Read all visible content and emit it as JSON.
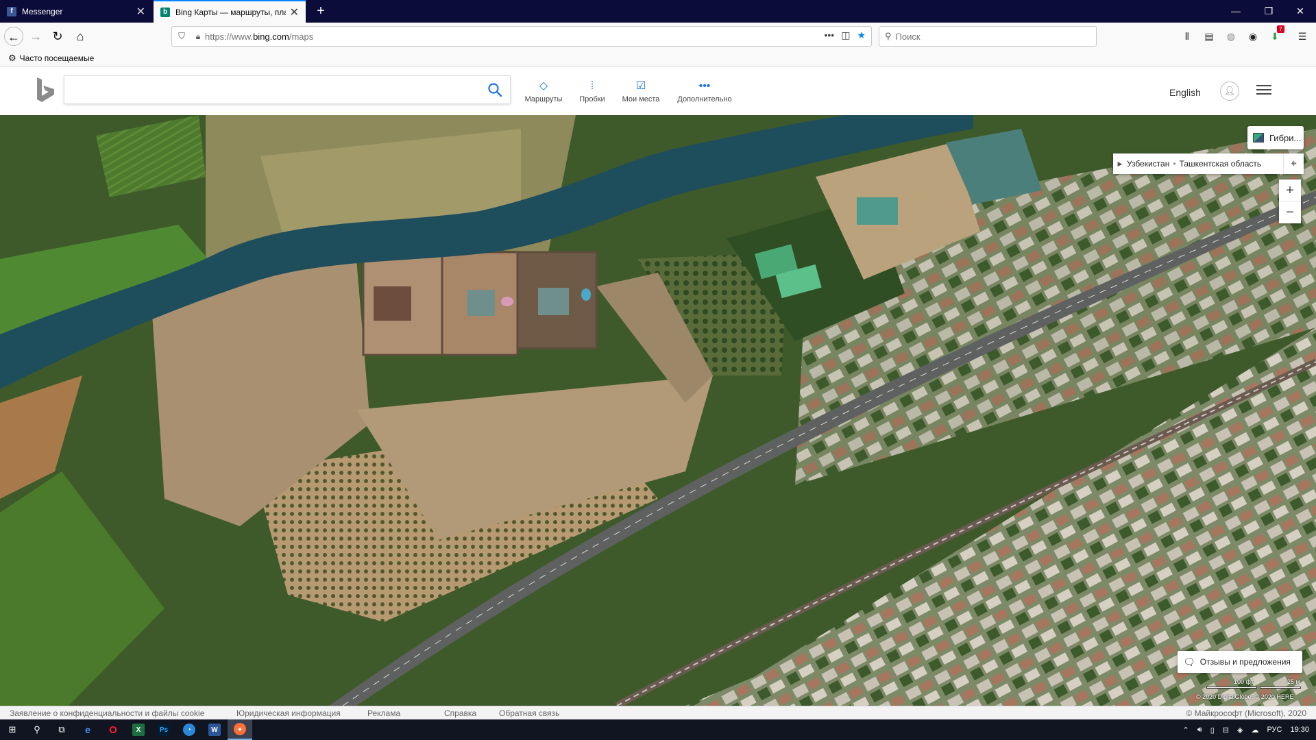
{
  "browser": {
    "tabs": [
      {
        "title": "Messenger",
        "favicon": "facebook-icon",
        "active": false
      },
      {
        "title": "Bing Карты — маршруты, пла",
        "favicon": "bing-icon",
        "active": true
      }
    ],
    "url": {
      "scheme": "https://www.",
      "domain": "bing.com",
      "path": "/maps"
    },
    "search_placeholder": "Поиск",
    "bookmark_item": "Часто посещаемые",
    "notification_count": "7"
  },
  "bing": {
    "nav": [
      {
        "label": "Маршруты",
        "icon": "directions-icon"
      },
      {
        "label": "Пробки",
        "icon": "traffic-icon"
      },
      {
        "label": "Мои места",
        "icon": "my-places-icon"
      },
      {
        "label": "Дополнительно",
        "icon": "more-icon"
      }
    ],
    "language": "English"
  },
  "map": {
    "layer_button": "Гибри...",
    "breadcrumb": [
      "Узбекистан",
      "Ташкентская область"
    ],
    "zoom_in": "+",
    "zoom_out": "−",
    "feedback": "Отзывы и предложения",
    "scale": {
      "imperial": "100 фт.",
      "metric": "25 м"
    },
    "attribution": "© 2020 DigitalGlobe, © 2020 HERE"
  },
  "footer": {
    "links": [
      "Заявление о конфиденциальности и файлы cookie",
      "Юридическая информация",
      "Реклама",
      "Справка",
      "Обратная связь"
    ],
    "copyright": "© Майкрософт (Microsoft), 2020"
  },
  "taskbar": {
    "language": "РУС",
    "time": "19:30"
  },
  "colors": {
    "accent": "#0a84ff",
    "tabstrip": "#0c0c3a",
    "taskbar": "#101521",
    "river": "#1e4d5c"
  }
}
